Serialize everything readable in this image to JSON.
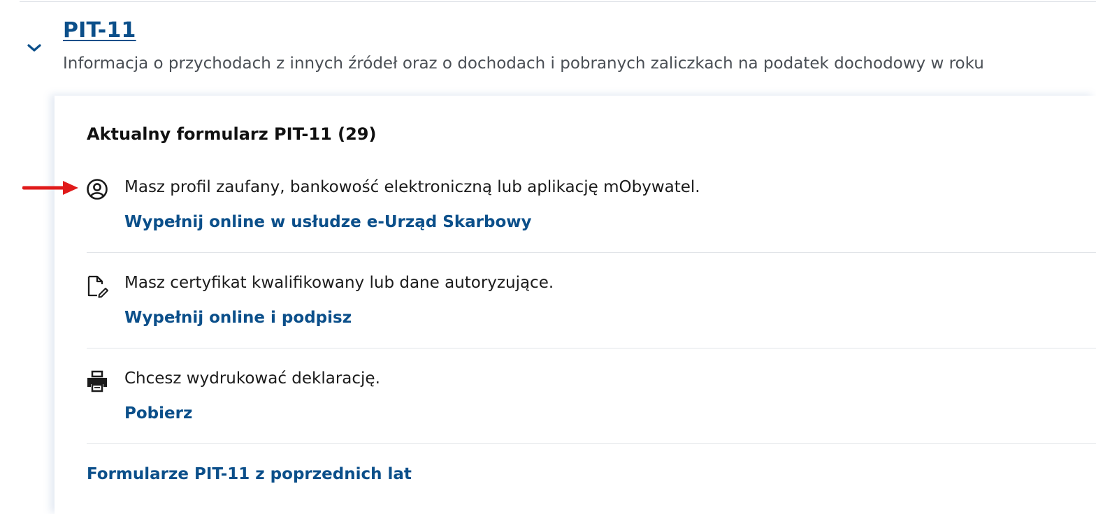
{
  "accordion": {
    "title": "PIT-11",
    "subtitle": "Informacja o przychodach z innych źródeł oraz o dochodach i pobranych zaliczkach na podatek dochodowy w roku",
    "expanded_icon": "chevron-down-icon"
  },
  "panel": {
    "title": "Aktualny formularz PIT-11 (29)",
    "options": [
      {
        "icon": "user-circle-icon",
        "text": "Masz profil zaufany, bankowość elektroniczną lub aplikację mObywatel.",
        "link": "Wypełnij online w usłudze e-Urząd Skarbowy"
      },
      {
        "icon": "document-sign-icon",
        "text": "Masz certyfikat kwalifikowany lub dane autoryzujące.",
        "link": "Wypełnij online i podpisz"
      },
      {
        "icon": "printer-icon",
        "text": "Chcesz wydrukować deklarację.",
        "link": "Pobierz"
      }
    ],
    "footer_link": "Formularze PIT-11 z poprzednich lat"
  },
  "annotation": {
    "icon": "red-arrow-icon",
    "color": "#e01a1a"
  },
  "colors": {
    "link": "#0b4f8a",
    "text": "#1b1b1b",
    "muted": "#4a4f55"
  }
}
